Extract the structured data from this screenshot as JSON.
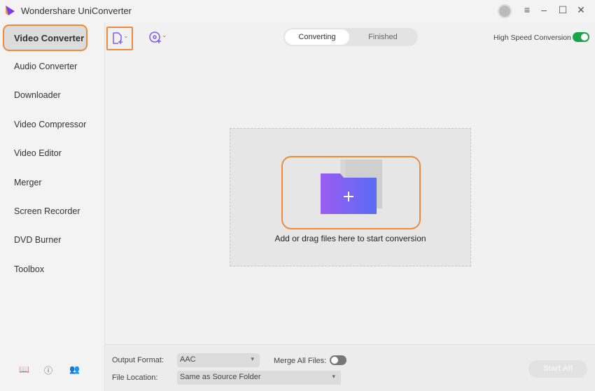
{
  "app": {
    "title": "Wondershare UniConverter"
  },
  "sidebar": {
    "items": [
      {
        "label": "Video Converter"
      },
      {
        "label": "Audio Converter"
      },
      {
        "label": "Downloader"
      },
      {
        "label": "Video Compressor"
      },
      {
        "label": "Video Editor"
      },
      {
        "label": "Merger"
      },
      {
        "label": "Screen Recorder"
      },
      {
        "label": "DVD Burner"
      },
      {
        "label": "Toolbox"
      }
    ]
  },
  "tabs": [
    {
      "label": "Converting"
    },
    {
      "label": "Finished"
    }
  ],
  "high_speed": {
    "label": "High Speed Conversion",
    "on": true
  },
  "dropzone": {
    "text": "Add or drag files here to start conversion"
  },
  "bottom": {
    "output_format_label": "Output Format:",
    "output_format": "AAC",
    "merge_label": "Merge All Files:",
    "file_location_label": "File Location:",
    "file_location": "Same as Source Folder",
    "start_all": "Start All"
  },
  "colors": {
    "accent": "#7b5cf0",
    "highlight": "#f08a3a",
    "toggle_on": "#1aa34a"
  }
}
